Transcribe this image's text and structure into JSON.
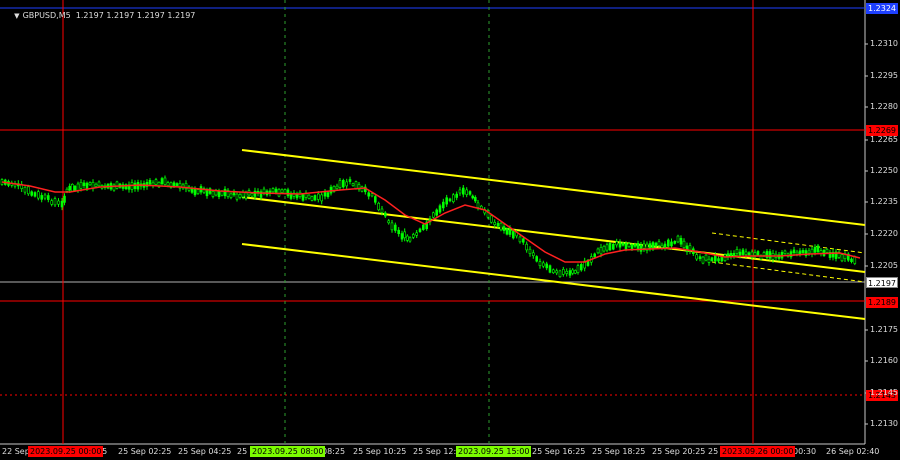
{
  "chart": {
    "title": "GBPUSD,M5  1.2197 1.2197 1.2197 1.2197",
    "title_icon": "triangle-down-icon",
    "y_ticks": [
      "1.2310",
      "1.2295",
      "1.2280",
      "1.2265",
      "1.2250",
      "1.2235",
      "1.2220",
      "1.2205",
      "1.2190",
      "1.2175",
      "1.2160",
      "1.2145",
      "1.2130"
    ],
    "x_ticks": [
      "22 Sep 2",
      "55",
      "25 Sep 02:25",
      "25 Sep 04:25",
      "25 S",
      "08:25",
      "25 Sep 10:25",
      "25 Sep 12:2",
      "25 Sep 16:25",
      "25 Sep 18:25",
      "25 Sep 20:25",
      "25 S",
      "00:30",
      "26 Sep 02:40"
    ],
    "price_labels": {
      "top_level": "1.2324",
      "resistance_1": "1.2269",
      "current": "1.2197",
      "support_1": "1.2189",
      "support_2": "1.2143"
    },
    "time_tags": {
      "tag1": "2023.09.25 00:00",
      "tag2": "2023.09.25 08:00",
      "tag3": "2023.09.25 15:00",
      "tag4": "2023.09.26 00:00"
    },
    "colors": {
      "background": "#000000",
      "bull_candle": "#00ff00",
      "bear_candle": "#00ff00",
      "moving_average": "#ff2020",
      "channel": "#ffff00",
      "level_red": "#ff0000",
      "level_blue": "#1e40ff",
      "vertical_green": "#2e9e2e",
      "vertical_red": "#ff0000",
      "current_price": "#b0b0b0"
    }
  }
}
